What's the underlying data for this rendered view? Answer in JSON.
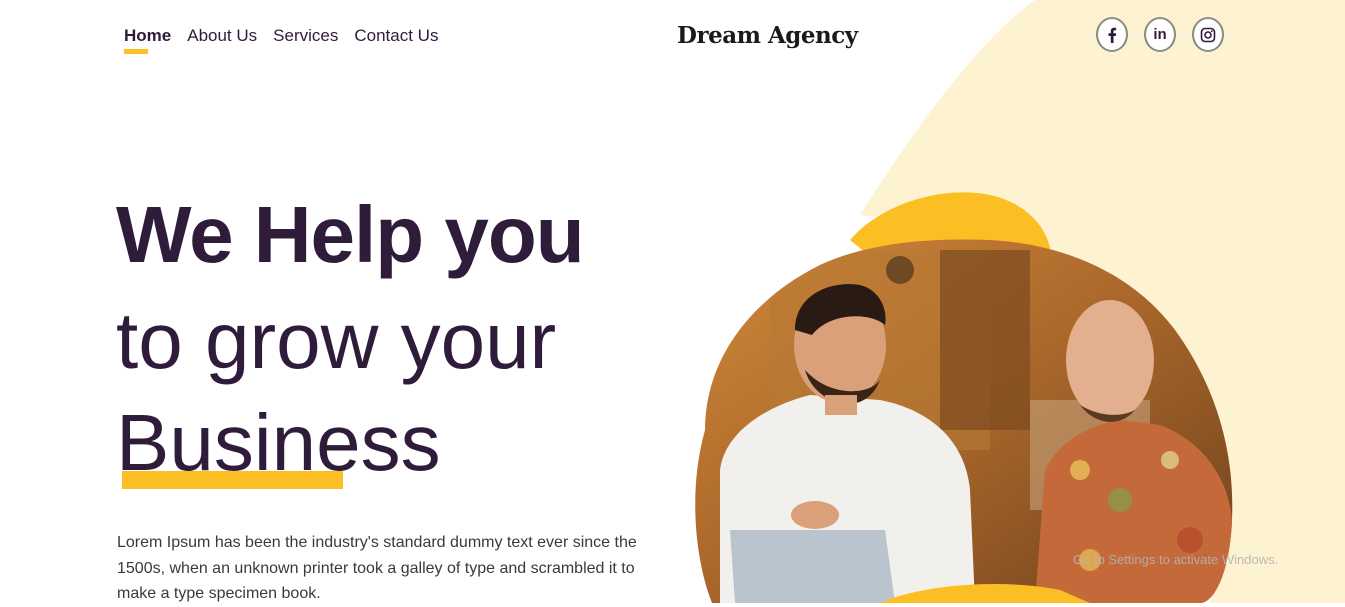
{
  "nav": {
    "items": [
      {
        "label": "Home",
        "active": true
      },
      {
        "label": "About Us",
        "active": false
      },
      {
        "label": "Services",
        "active": false
      },
      {
        "label": "Contact Us",
        "active": false
      }
    ]
  },
  "brand": {
    "name": "Dream Agency"
  },
  "social": [
    {
      "icon": "facebook-icon",
      "glyph": "f"
    },
    {
      "icon": "linkedin-icon",
      "glyph": "in"
    },
    {
      "icon": "instagram-icon",
      "glyph": ""
    }
  ],
  "hero": {
    "line1": "We Help you",
    "line2": "to grow your",
    "line3": "Business",
    "description": "Lorem Ipsum has been the industry's standard dummy text ever since the 1500s, when an unknown printer took a galley of type and scrambled it to make a type specimen book."
  },
  "watermark": {
    "text": "Go to Settings to activate Windows."
  },
  "colors": {
    "accent": "#fbbf24",
    "heading": "#2f1c3a",
    "bg_shape": "#fef3d0"
  }
}
